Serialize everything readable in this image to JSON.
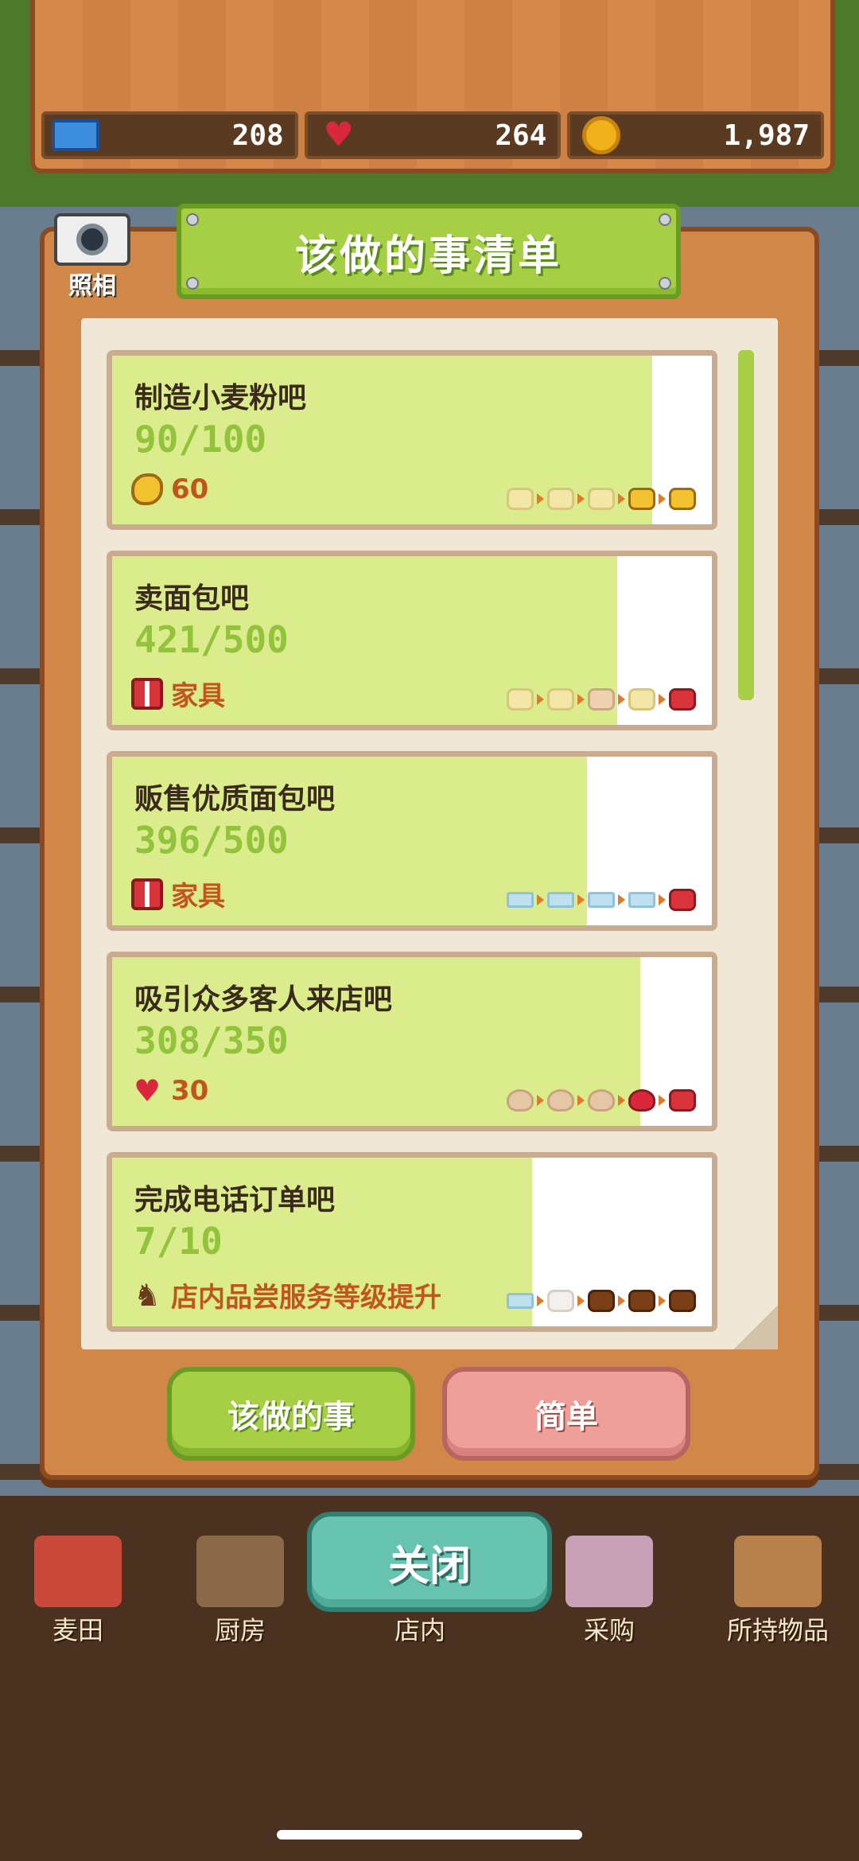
{
  "resources": {
    "tickets": "208",
    "hearts": "264",
    "coins": "1,987"
  },
  "camera": {
    "label": "照相"
  },
  "title": "该做的事清单",
  "tasks": [
    {
      "title": "制造小麦粉吧",
      "progress": "90/100",
      "progress_fraction": 0.9,
      "reward_icon": "bread-icon",
      "reward_text": "60",
      "steps": [
        "bread-pale",
        "bread-pale",
        "bread-pale",
        "bread",
        "bread"
      ]
    },
    {
      "title": "卖面包吧",
      "progress": "421/500",
      "progress_fraction": 0.842,
      "reward_icon": "gift-icon",
      "reward_text": "家具",
      "steps": [
        "bread-pale",
        "bread-pale",
        "gift-pale",
        "bread-pale",
        "gift"
      ]
    },
    {
      "title": "贩售优质面包吧",
      "progress": "396/500",
      "progress_fraction": 0.792,
      "reward_icon": "gift-icon",
      "reward_text": "家具",
      "steps": [
        "ticket-pale",
        "ticket-pale",
        "ticket-pale",
        "ticket-pale",
        "gift"
      ]
    },
    {
      "title": "吸引众多客人来店吧",
      "progress": "308/350",
      "progress_fraction": 0.88,
      "reward_icon": "heart-icon",
      "reward_text": "30",
      "steps": [
        "heart-pale",
        "heart-pale",
        "heart-pale",
        "heart",
        "gift"
      ]
    },
    {
      "title": "完成电话订单吧",
      "progress": "7/10",
      "progress_fraction": 0.7,
      "reward_icon": "chair-icon",
      "reward_text": "店内品尝服务等级提升",
      "steps": [
        "ticket-pale",
        "chair-pale",
        "chair",
        "chair",
        "chair"
      ]
    }
  ],
  "buttons": {
    "todo": "该做的事",
    "simple": "简单",
    "close": "关闭"
  },
  "nav": [
    {
      "label": "麦田",
      "icon": "wheat-field-icon"
    },
    {
      "label": "厨房",
      "icon": "kitchen-icon"
    },
    {
      "label": "店内",
      "icon": "shop-icon"
    },
    {
      "label": "采购",
      "icon": "purchase-icon"
    },
    {
      "label": "所持物品",
      "icon": "inventory-icon"
    }
  ],
  "colors": {
    "progress_fill": "#dbec8c",
    "progress_text": "#93c23d",
    "reward_text": "#c2541e",
    "banner_green": "#a6cf45",
    "button_pink": "#ee9f9a",
    "button_teal": "#67c4b0"
  }
}
